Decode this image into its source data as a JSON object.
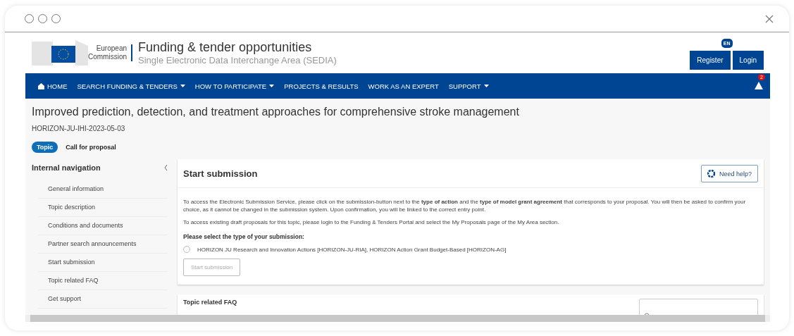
{
  "header": {
    "org": [
      "European",
      "Commission"
    ],
    "title": "Funding & tender opportunities",
    "subtitle": "Single Electronic Data Interchange Area (SEDIA)",
    "language": "EN",
    "buttons": [
      "Register",
      "Login"
    ]
  },
  "nav": {
    "items": [
      {
        "label": "HOME",
        "kind": "home"
      },
      {
        "label": "SEARCH FUNDING & TENDERS",
        "kind": "dropdown"
      },
      {
        "label": "HOW TO PARTICIPATE",
        "kind": "dropdown"
      },
      {
        "label": "PROJECTS & RESULTS",
        "kind": "link"
      },
      {
        "label": "WORK AS AN EXPERT",
        "kind": "link"
      },
      {
        "label": "SUPPORT",
        "kind": "dropdown"
      }
    ],
    "alert_count": "2"
  },
  "topic": {
    "title": "Improved prediction, detection, and treatment approaches for comprehensive stroke management",
    "code": "HORIZON-JU-IHI-2023-05-03",
    "tabs": [
      {
        "label": "Topic",
        "selected": true
      },
      {
        "label": "Call for proposal",
        "selected": false
      }
    ]
  },
  "sidebar": {
    "title": "Internal navigation",
    "items": [
      "General information",
      "Topic description",
      "Conditions and documents",
      "Partner search announcements",
      "Start submission",
      "Topic related FAQ",
      "Get support"
    ]
  },
  "submission": {
    "title": "Start submission",
    "help": "Need help?",
    "paragraphs": [
      "To access the Electronic Submission Service, please click on the submission-button next to the **type of action** and the **type of model grant agreement** that corresponds to your proposal. You will then be asked to confirm your choice, as it cannot be changed in the submission system. Upon confirmation, you will be linked to the correct entry point.",
      "To access existing draft proposals for this topic, please login to the Funding & Tenders Portal and select the My Proposals page of the My Area section."
    ],
    "question": "Please select the type of your submission:",
    "options": [
      {
        "label": "HORIZON JU Research and Innovation Actions [HORIZON-JU-RIA], HORIZON Action Grant Budget-Based [HORIZON-AG]",
        "selected": false
      }
    ],
    "button": {
      "label": "Start submission",
      "disabled": true
    }
  },
  "faq": {
    "title": "Topic related FAQ"
  }
}
